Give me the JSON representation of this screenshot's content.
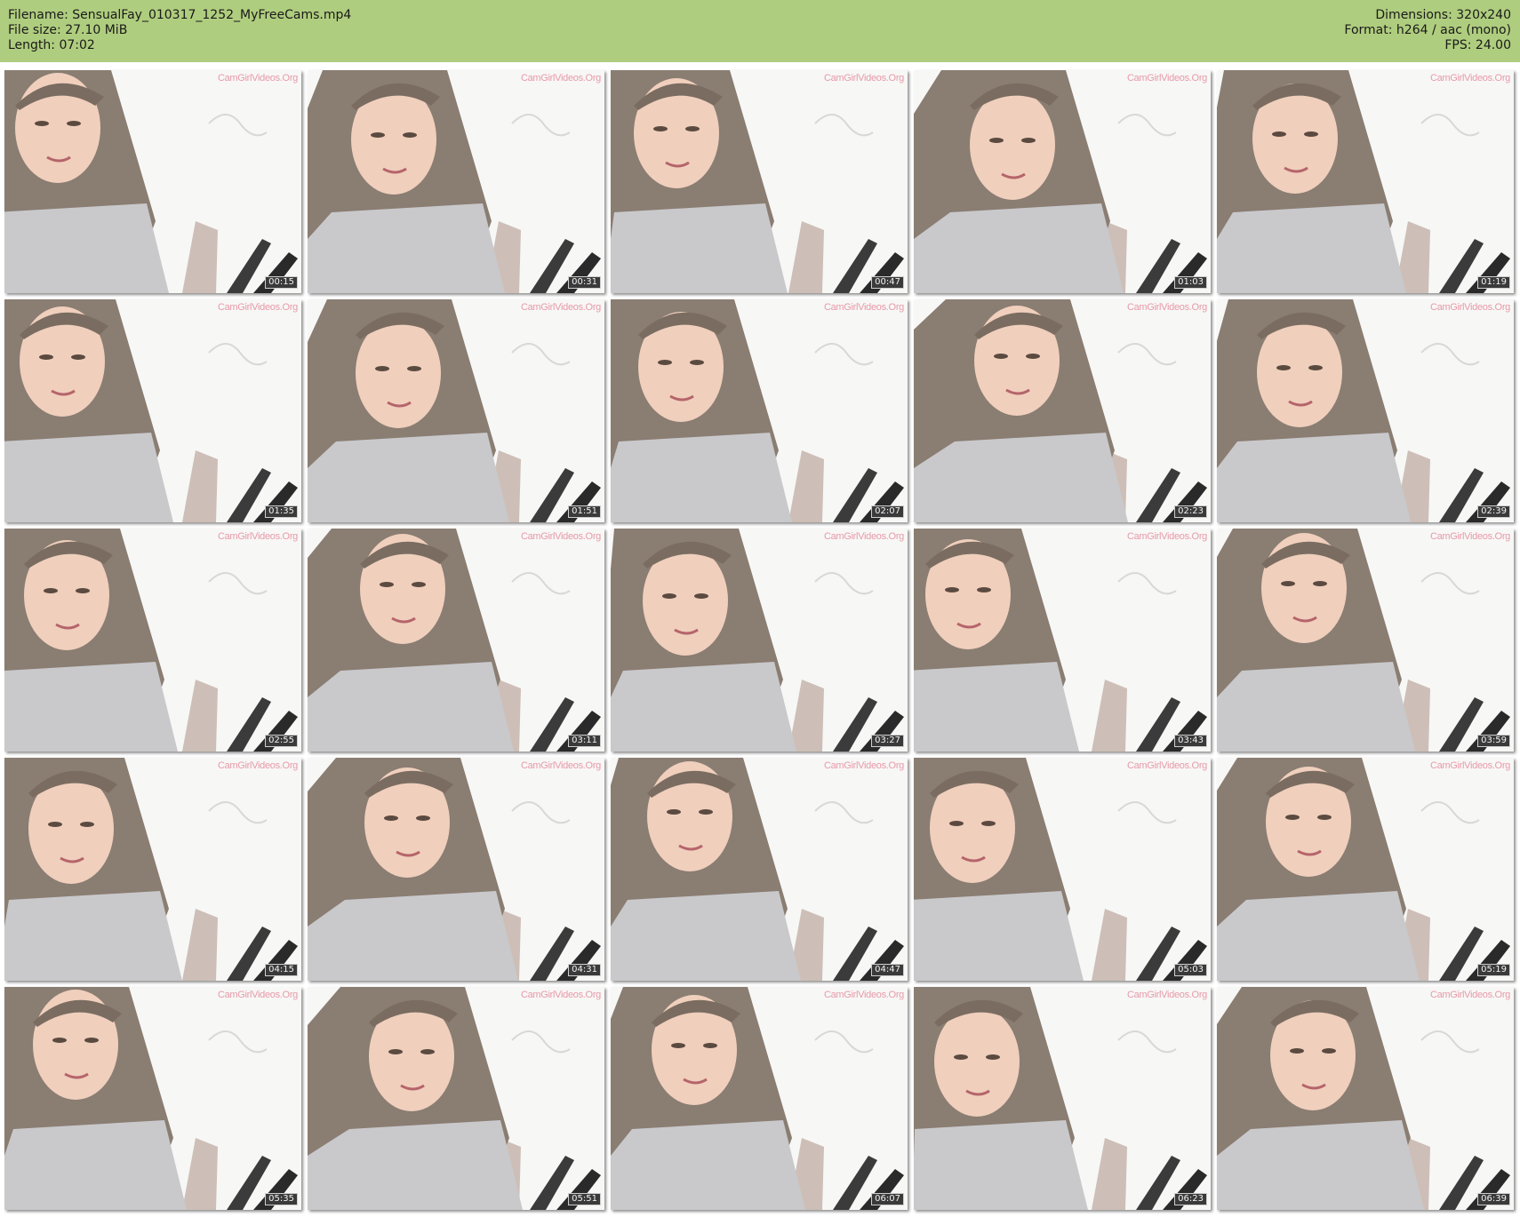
{
  "header": {
    "filename_line": "Filename: SensualFay_010317_1252_MyFreeCams.mp4",
    "filesize_line": "File size: 27.10 MiB",
    "length_line": "Length: 07:02",
    "dimensions_line": "Dimensions: 320x240",
    "format_line": "Format: h264 / aac (mono)",
    "fps_line": "FPS: 24.00",
    "background_color": "#afcd7e"
  },
  "thumbnails": [
    {
      "time": "00:15",
      "watermark": "CamGirlVideos.Org"
    },
    {
      "time": "00:31",
      "watermark": "CamGirlVideos.Org"
    },
    {
      "time": "00:47",
      "watermark": "CamGirlVideos.Org"
    },
    {
      "time": "01:03",
      "watermark": "CamGirlVideos.Org"
    },
    {
      "time": "01:19",
      "watermark": "CamGirlVideos.Org"
    },
    {
      "time": "01:35",
      "watermark": "CamGirlVideos.Org"
    },
    {
      "time": "01:51",
      "watermark": "CamGirlVideos.Org"
    },
    {
      "time": "02:07",
      "watermark": "CamGirlVideos.Org"
    },
    {
      "time": "02:23",
      "watermark": "CamGirlVideos.Org"
    },
    {
      "time": "02:39",
      "watermark": "CamGirlVideos.Org"
    },
    {
      "time": "02:55",
      "watermark": "CamGirlVideos.Org"
    },
    {
      "time": "03:11",
      "watermark": "CamGirlVideos.Org"
    },
    {
      "time": "03:27",
      "watermark": "CamGirlVideos.Org"
    },
    {
      "time": "03:43",
      "watermark": "CamGirlVideos.Org"
    },
    {
      "time": "03:59",
      "watermark": "CamGirlVideos.Org"
    },
    {
      "time": "04:15",
      "watermark": "CamGirlVideos.Org"
    },
    {
      "time": "04:31",
      "watermark": "CamGirlVideos.Org"
    },
    {
      "time": "04:47",
      "watermark": "CamGirlVideos.Org"
    },
    {
      "time": "05:03",
      "watermark": "CamGirlVideos.Org"
    },
    {
      "time": "05:19",
      "watermark": "CamGirlVideos.Org"
    },
    {
      "time": "05:35",
      "watermark": "CamGirlVideos.Org"
    },
    {
      "time": "05:51",
      "watermark": "CamGirlVideos.Org"
    },
    {
      "time": "06:07",
      "watermark": "CamGirlVideos.Org"
    },
    {
      "time": "06:23",
      "watermark": "CamGirlVideos.Org"
    },
    {
      "time": "06:39",
      "watermark": "CamGirlVideos.Org"
    }
  ]
}
